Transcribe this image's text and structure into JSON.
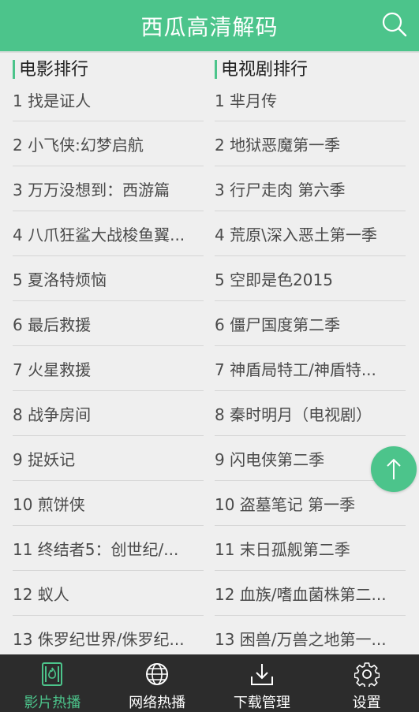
{
  "header": {
    "title": "西瓜高清解码",
    "search_icon": "search-icon"
  },
  "colors": {
    "accent": "#4cc48b",
    "tabbar": "#2c2c2c"
  },
  "movies": {
    "heading": "电影排行",
    "items": [
      "1 找是证人",
      "2 小飞侠:幻梦启航",
      "3 万万没想到：西游篇",
      "4 八爪狂鲨大战梭鱼翼...",
      "5 夏洛特烦恼",
      "6 最后救援",
      "7 火星救援",
      "8 战争房间",
      "9 捉妖记",
      "10 煎饼侠",
      "11 终结者5：创世纪/...",
      "12 蚁人",
      "13 侏罗纪世界/侏罗纪..."
    ]
  },
  "tv": {
    "heading": "电视剧排行",
    "items": [
      "1 芈月传",
      "2 地狱恶魔第一季",
      "3 行尸走肉 第六季",
      "4 荒原\\深入恶土第一季",
      "5 空即是色2015",
      "6 僵尸国度第二季",
      "7 神盾局特工/神盾特...",
      "8 秦时明月（电视剧）",
      "9 闪电侠第二季",
      "10 盗墓笔记 第一季",
      "11 末日孤舰第二季",
      "12 血族/嗜血菌株第二...",
      "13 困兽/万兽之地第一..."
    ]
  },
  "fab": {
    "icon": "arrow-up-icon"
  },
  "tabs": [
    {
      "label": "影片热播",
      "icon": "flame-icon",
      "active": true
    },
    {
      "label": "网络热播",
      "icon": "globe-icon",
      "active": false
    },
    {
      "label": "下载管理",
      "icon": "download-icon",
      "active": false
    },
    {
      "label": "设置",
      "icon": "gear-icon",
      "active": false
    }
  ]
}
